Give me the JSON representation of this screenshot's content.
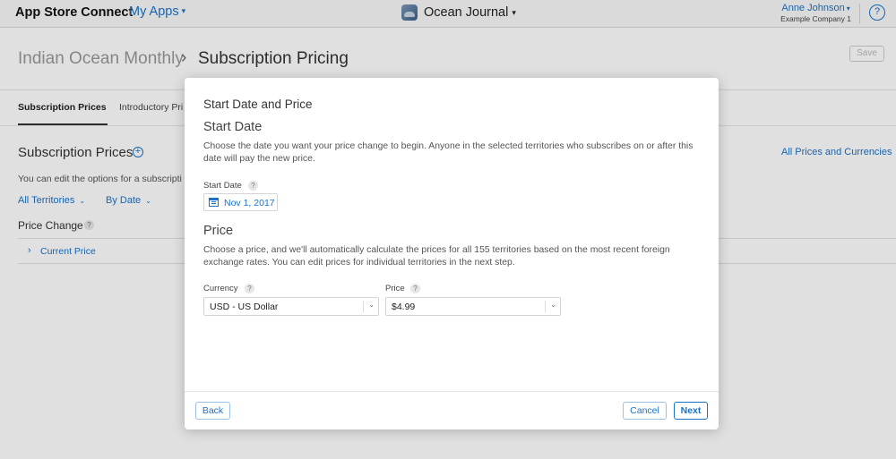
{
  "topbar": {
    "brand": "App Store Connect",
    "my_apps": "My Apps",
    "app_name": "Ocean Journal",
    "user_name": "Anne Johnson",
    "company": "Example Company 1",
    "help": "?"
  },
  "header": {
    "breadcrumb_parent": "Indian Ocean Monthly",
    "breadcrumb_separator": "›",
    "breadcrumb_current": "Subscription Pricing",
    "save_label": "Save"
  },
  "tabs": [
    {
      "label": "Subscription Prices",
      "active": true
    },
    {
      "label": "Introductory Pri",
      "active": false
    }
  ],
  "main": {
    "section_title": "Subscription Prices",
    "add_icon": "+",
    "all_prices_link": "All Prices and Currencies",
    "description": "You can edit the options for a subscripti",
    "filter_territories": "All Territories",
    "filter_date": "By Date",
    "price_change_label": "Price Change",
    "help_badge": "?",
    "current_price": "Current Price"
  },
  "modal": {
    "title": "Start Date and Price",
    "start_date_heading": "Start Date",
    "start_date_desc": "Choose the date you want your price change to begin. Anyone in the selected territories who subscribes on or after this date will pay the new price.",
    "start_date_label": "Start Date",
    "start_date_value": "Nov 1, 2017",
    "price_heading": "Price",
    "price_desc": "Choose a price, and we'll automatically calculate the prices for all 155 territories based on the most recent foreign exchange rates. You can edit prices for individual territories in the next step.",
    "currency_label": "Currency",
    "currency_value": "USD - US Dollar",
    "price_label": "Price",
    "price_value": "$4.99",
    "help_badge": "?",
    "back_label": "Back",
    "cancel_label": "Cancel",
    "next_label": "Next"
  },
  "colors": {
    "accent": "#1a73c8",
    "overlay": "rgba(0,0,0,0.12)"
  }
}
